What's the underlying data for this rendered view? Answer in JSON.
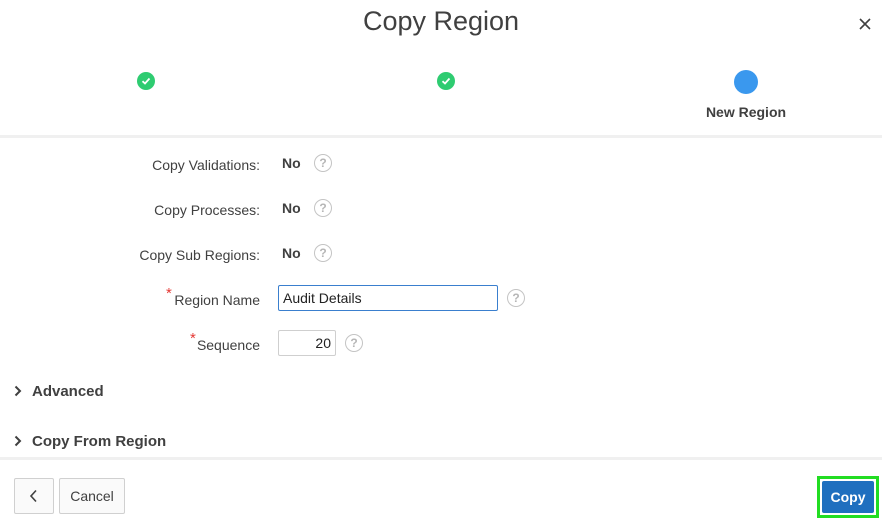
{
  "dialog": {
    "title": "Copy Region",
    "close_icon": "close-icon"
  },
  "wizard": {
    "steps": [
      {
        "label": "",
        "state": "complete"
      },
      {
        "label": "",
        "state": "complete"
      },
      {
        "label": "New Region",
        "state": "current"
      }
    ]
  },
  "form": {
    "copy_validations": {
      "label": "Copy Validations:",
      "value": "No"
    },
    "copy_processes": {
      "label": "Copy Processes:",
      "value": "No"
    },
    "copy_sub_regions": {
      "label": "Copy Sub Regions:",
      "value": "No"
    },
    "region_name": {
      "label": "Region Name",
      "value": "Audit Details",
      "required_mark": "*"
    },
    "sequence": {
      "label": "Sequence",
      "value": "20",
      "required_mark": "*"
    },
    "help_glyph": "?"
  },
  "sections": {
    "advanced": "Advanced",
    "copy_from_region": "Copy From Region"
  },
  "footer": {
    "back_icon": "chevron-left-icon",
    "cancel_label": "Cancel",
    "copy_label": "Copy"
  },
  "colors": {
    "step_complete": "#2ecc71",
    "step_current": "#3a98ee",
    "primary_button": "#1f6fbf",
    "highlight": "#22dd22",
    "required": "#e53935"
  }
}
